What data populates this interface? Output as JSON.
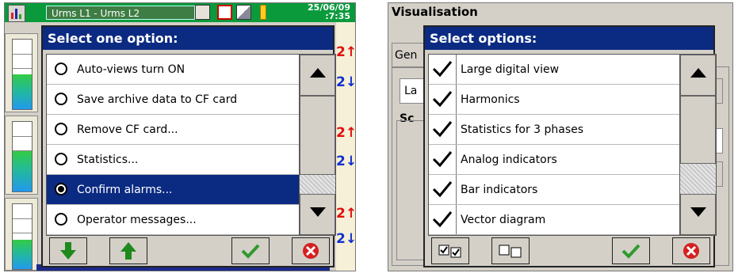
{
  "left_screen": {
    "topbar": {
      "title": "Urms L1 - Urms L2",
      "date": "25/06/09",
      "time": ":7:35"
    },
    "alarm_arrows": [
      "2↑",
      "2↓",
      "2↑",
      "2↓",
      "2↑",
      "2↓"
    ],
    "dialog": {
      "title": "Select one option:",
      "options": [
        {
          "label": "Auto-views turn ON",
          "selected": false
        },
        {
          "label": "Save archive data to CF card",
          "selected": false
        },
        {
          "label": "Remove CF card...",
          "selected": false
        },
        {
          "label": "Statistics...",
          "selected": false
        },
        {
          "label": "Confirm alarms...",
          "selected": true
        },
        {
          "label": "Operator messages...",
          "selected": false
        }
      ],
      "buttons": [
        "arrow-down-icon",
        "arrow-up-icon",
        "ok-check-icon",
        "cancel-x-icon"
      ]
    }
  },
  "right_screen": {
    "window_title": "Visualisation",
    "tab_label": "Gen",
    "field_label": "La",
    "group_label": "Sc",
    "dialog": {
      "title": "Select options:",
      "options": [
        {
          "label": "Large digital view",
          "checked": true
        },
        {
          "label": "Harmonics",
          "checked": true
        },
        {
          "label": "Statistics for 3 phases",
          "checked": true
        },
        {
          "label": "Analog indicators",
          "checked": true
        },
        {
          "label": "Bar indicators",
          "checked": true
        },
        {
          "label": "Vector diagram",
          "checked": true
        }
      ],
      "buttons": [
        "select-all-icon",
        "deselect-all-icon",
        "ok-check-icon",
        "cancel-x-icon"
      ]
    }
  },
  "colors": {
    "title_bar": "#0b2a82",
    "top_bar_green": "#0a9a3c",
    "ok_green": "#2f9a2f",
    "cancel_red": "#d42020",
    "alarm_red": "#e01010",
    "alarm_blue": "#1030d0"
  }
}
